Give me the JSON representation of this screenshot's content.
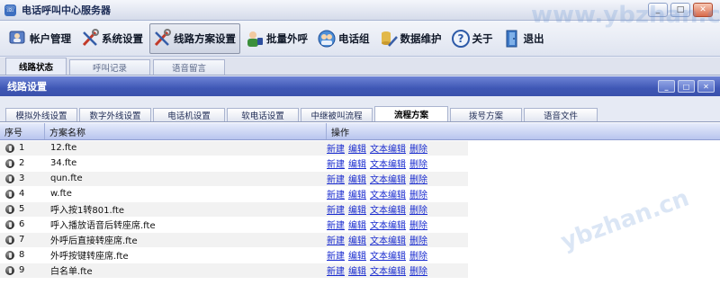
{
  "window": {
    "title": "电话呼叫中心服务器",
    "controls": [
      "_",
      "□",
      "✕"
    ]
  },
  "toolbar": [
    {
      "label": "帐户管理",
      "icon": "user-account-icon"
    },
    {
      "label": "系统设置",
      "icon": "tools-icon"
    },
    {
      "label": "线路方案设置",
      "icon": "tools-icon",
      "active": true
    },
    {
      "label": "批量外呼",
      "icon": "person-phone-icon"
    },
    {
      "label": "电话组",
      "icon": "group-icon"
    },
    {
      "label": "数据维护",
      "icon": "database-tools-icon"
    },
    {
      "label": "关于",
      "icon": "help-icon"
    },
    {
      "label": "退出",
      "icon": "exit-icon"
    }
  ],
  "top_tabs": [
    {
      "label": "线路状态",
      "active": true
    },
    {
      "label": "呼叫记录"
    },
    {
      "label": "语音留言"
    }
  ],
  "inner_window": {
    "title": "线路设置",
    "controls": [
      "_",
      "□",
      "✕"
    ]
  },
  "sub_tabs": [
    {
      "label": "模拟外线设置"
    },
    {
      "label": "数字外线设置"
    },
    {
      "label": "电话机设置"
    },
    {
      "label": "软电话设置"
    },
    {
      "label": "中继被叫流程"
    },
    {
      "label": "流程方案",
      "active": true
    },
    {
      "label": "拨号方案"
    },
    {
      "label": "语音文件"
    }
  ],
  "table": {
    "headers": [
      "序号",
      "方案名称",
      "操作"
    ],
    "ops": [
      "新建",
      "编辑",
      "文本编辑",
      "删除"
    ],
    "rows": [
      {
        "idx": "1",
        "name": "12.fte"
      },
      {
        "idx": "2",
        "name": "34.fte"
      },
      {
        "idx": "3",
        "name": "qun.fte"
      },
      {
        "idx": "4",
        "name": "w.fte"
      },
      {
        "idx": "5",
        "name": "呼入按1转801.fte"
      },
      {
        "idx": "6",
        "name": "呼入播放语音后转座席.fte"
      },
      {
        "idx": "7",
        "name": "外呼后直接转座席.fte"
      },
      {
        "idx": "8",
        "name": "外呼按键转座席.fte"
      },
      {
        "idx": "9",
        "name": "白名单.fte"
      }
    ]
  },
  "watermarks": [
    "www.ybzhan.cn",
    "ybzhan.cn"
  ],
  "colors": {
    "inner_title_bar": "#3f57b5",
    "link": "#1a2ccf",
    "header_grad": "#b8c5ee"
  }
}
